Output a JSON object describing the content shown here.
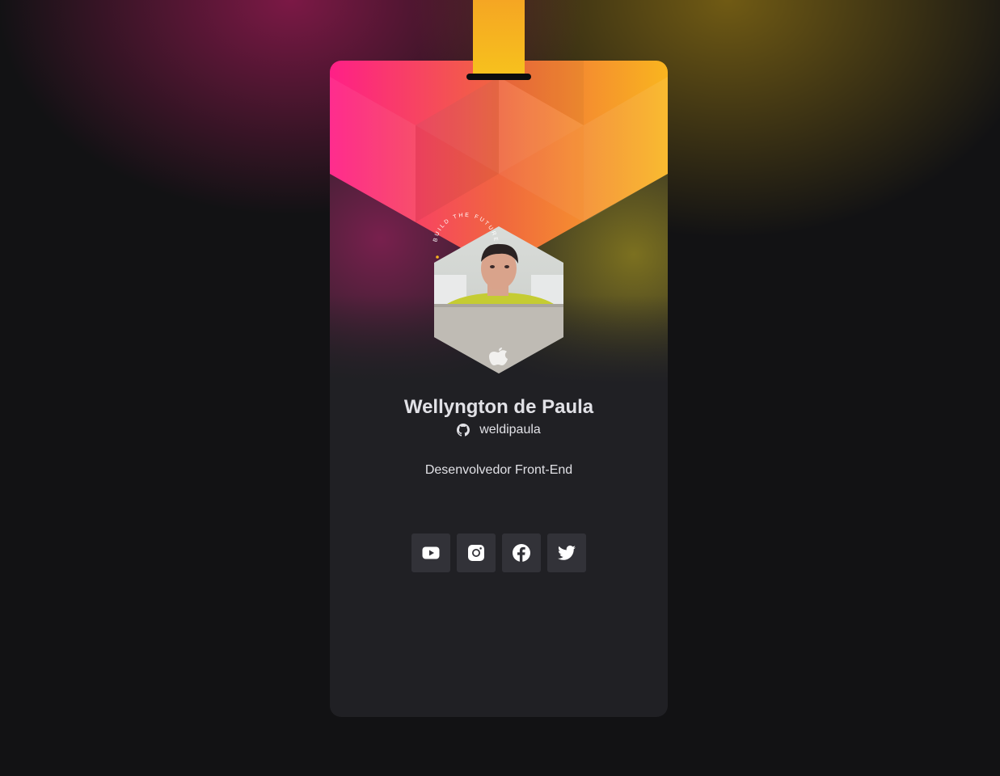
{
  "profile": {
    "name": "Wellyngton de Paula",
    "github_username": "weldipaula",
    "role": "Desenvolvedor Front-End",
    "badge_circle_text": "BUILD THE FUTURE"
  },
  "socials": [
    {
      "icon": "youtube-icon"
    },
    {
      "icon": "instagram-icon"
    },
    {
      "icon": "facebook-icon"
    },
    {
      "icon": "twitter-icon"
    }
  ],
  "colors": {
    "card_bg": "#202024",
    "page_bg": "#121214",
    "strap": "#f7c21d",
    "gradient_start": "#ff1f87",
    "gradient_end": "#f9b51f",
    "text": "#e1e1e6",
    "social_btn_bg": "#323238"
  }
}
